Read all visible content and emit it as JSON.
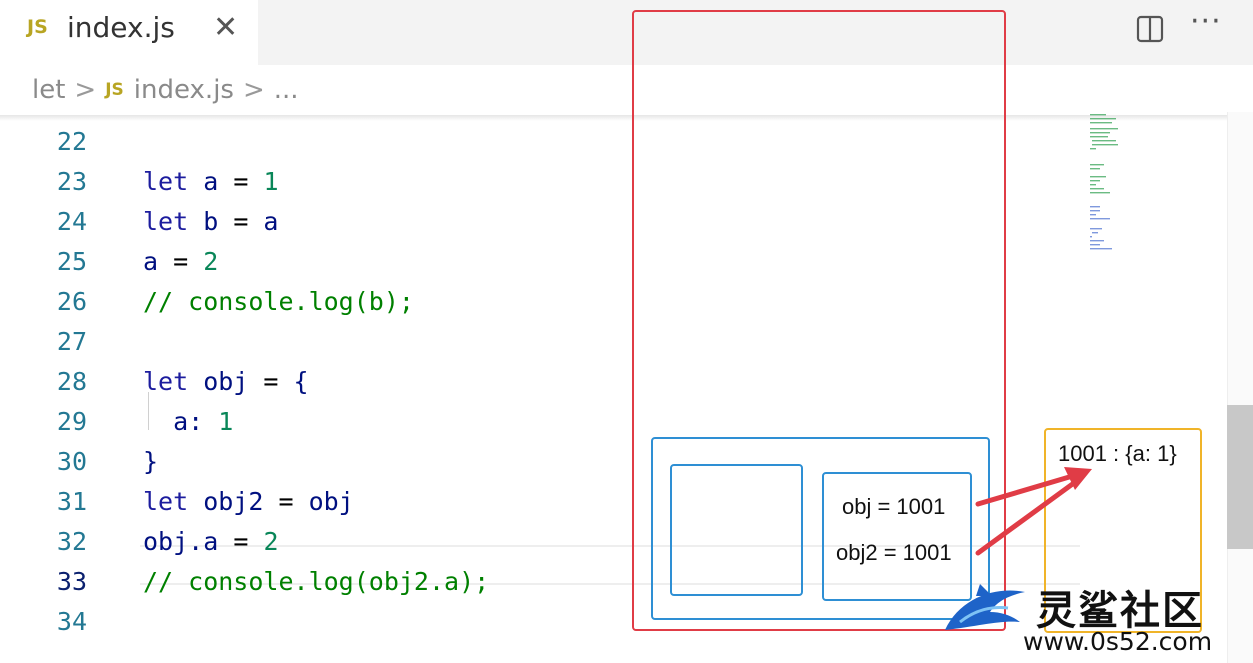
{
  "tab": {
    "badge": "JS",
    "title": "index.js",
    "close": "✕"
  },
  "toolbar": {
    "more": "···"
  },
  "breadcrumb": {
    "folder": "let",
    "badge": "JS",
    "file": "index.js",
    "more": "...",
    "sep": ">"
  },
  "editor": {
    "active_line": 33,
    "lines": [
      {
        "n": "22",
        "code": ""
      },
      {
        "n": "23",
        "code": "let a = 1"
      },
      {
        "n": "24",
        "code": "let b = a"
      },
      {
        "n": "25",
        "code": "a = 2"
      },
      {
        "n": "26",
        "code": "// console.log(b);"
      },
      {
        "n": "27",
        "code": ""
      },
      {
        "n": "28",
        "code": "let obj = {"
      },
      {
        "n": "29",
        "code": "  a: 1"
      },
      {
        "n": "30",
        "code": "}"
      },
      {
        "n": "31",
        "code": "let obj2 = obj"
      },
      {
        "n": "32",
        "code": "obj.a = 2"
      },
      {
        "n": "33",
        "code": "// console.log(obj2.a);"
      },
      {
        "n": "34",
        "code": ""
      }
    ]
  },
  "annotations": {
    "stack_obj": "obj = 1001",
    "stack_obj2": "obj2 = 1001",
    "heap": "1001 :   {a: 1}",
    "colors": {
      "stack_frame": "#e03c46",
      "stack_box": "#2e8fd4",
      "heap_box": "#f0b429"
    }
  },
  "watermark": {
    "cn": "灵鲨社区",
    "url": "www.0s52.com"
  }
}
